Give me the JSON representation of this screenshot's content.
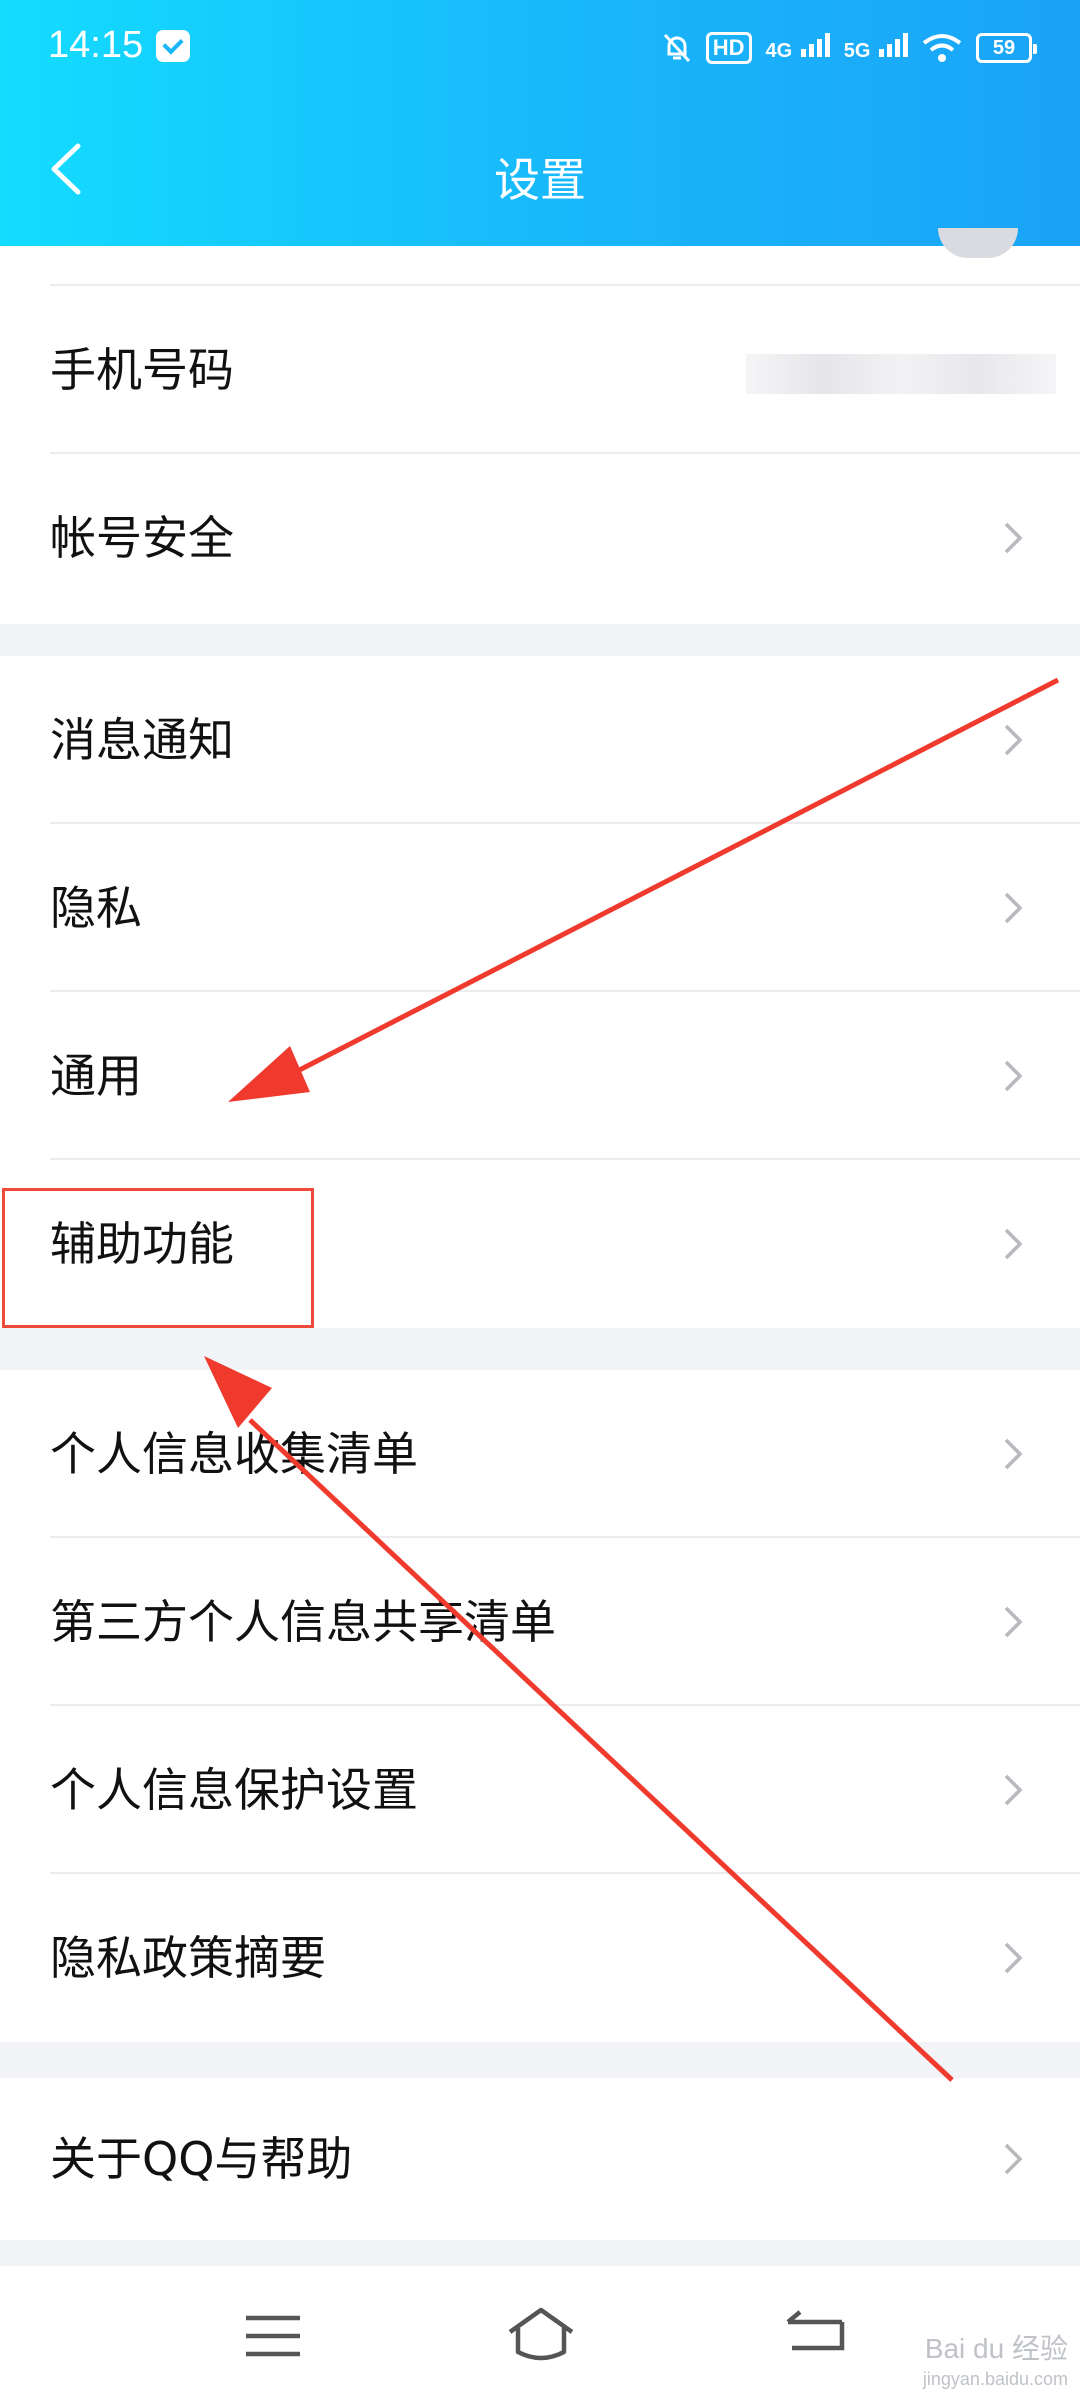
{
  "status_bar": {
    "time": "14:15",
    "network_a": "4G",
    "network_b": "5G",
    "battery": "59"
  },
  "header": {
    "title": "设置"
  },
  "groups": [
    {
      "items": [
        {
          "label": "手机号码",
          "value": ""
        },
        {
          "label": "帐号安全"
        }
      ]
    },
    {
      "items": [
        {
          "label": "消息通知"
        },
        {
          "label": "隐私"
        },
        {
          "label": "通用"
        },
        {
          "label": "辅助功能"
        }
      ]
    },
    {
      "items": [
        {
          "label": "个人信息收集清单"
        },
        {
          "label": "第三方个人信息共享清单"
        },
        {
          "label": "个人信息保护设置"
        },
        {
          "label": "隐私政策摘要"
        }
      ]
    },
    {
      "items": [
        {
          "label": "关于QQ与帮助"
        }
      ]
    }
  ],
  "annotations": {
    "color": "#f03a2e",
    "highlighted_item": "辅助功能"
  },
  "watermark": {
    "brand": "Bai du 经验",
    "url": "jingyan.baidu.com"
  },
  "colors": {
    "header_start": "#13dcff",
    "header_end": "#1aa3f7",
    "background": "#f3f4f8"
  }
}
